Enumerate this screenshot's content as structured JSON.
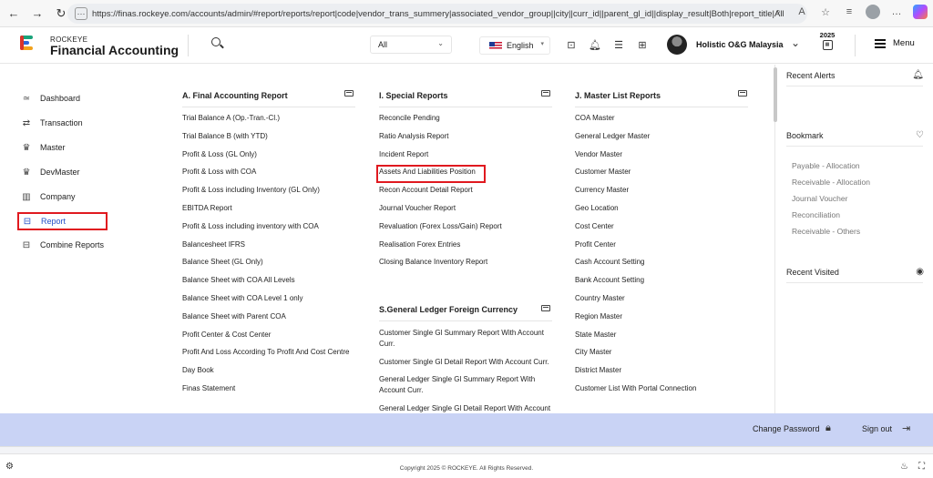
{
  "browser": {
    "url": "https://finas.rockeye.com/accounts/admin/#report/reports/report|code|vendor_trans_summery|associated_vendor_group||city||curr_id||parent_gl_id||display_result|Both|report_title|All..."
  },
  "header": {
    "brand_small": "ROCKEYE",
    "brand_big": "Financial Accounting",
    "scope_value": "All",
    "language": "English",
    "company": "Holistic O&G Malaysia",
    "year": "2025",
    "menu_label": "Menu"
  },
  "sidebar": {
    "items": [
      {
        "label": "Dashboard",
        "icon": "dashboard-icon"
      },
      {
        "label": "Transaction",
        "icon": "transaction-icon"
      },
      {
        "label": "Master",
        "icon": "crown-icon"
      },
      {
        "label": "DevMaster",
        "icon": "crown-icon"
      },
      {
        "label": "Company",
        "icon": "building-icon"
      },
      {
        "label": "Report",
        "icon": "report-icon"
      },
      {
        "label": "Combine Reports",
        "icon": "report-icon"
      }
    ]
  },
  "columns": [
    {
      "title": "A. Final Accounting Report",
      "links": [
        "Trial Balance A (Op.-Tran.-Cl.)",
        "Trial Balance B (with YTD)",
        "Profit & Loss (GL Only)",
        "Profit & Loss with COA",
        "Profit & Loss including Inventory (GL Only)",
        "EBITDA Report",
        "Profit & Loss including inventory with COA",
        "Balancesheet IFRS",
        "Balance Sheet (GL Only)",
        "Balance Sheet with COA All Levels",
        "Balance Sheet with COA Level 1 only",
        "Balance Sheet with Parent COA",
        "Profit Center & Cost Center",
        "Profit And Loss According To Profit And Cost Centre",
        "Day Book",
        "Finas Statement"
      ]
    },
    {
      "title": "I. Special Reports",
      "links": [
        "Reconcile Pending",
        "Ratio Analysis Report",
        "Incident Report",
        "Assets And Liabilities Position",
        "Recon Account Detail Report",
        "Journal Voucher Report",
        "Revaluation (Forex Loss/Gain) Report",
        "Realisation Forex Entries",
        "Closing Balance Inventory Report"
      ]
    },
    {
      "title": "J. Master List Reports",
      "links": [
        "COA Master",
        "General Ledger Master",
        "Vendor Master",
        "Customer Master",
        "Currency Master",
        "Geo Location",
        "Cost Center",
        "Profit Center",
        "Cash Account Setting",
        "Bank Account Setting",
        "Country Master",
        "Region Master",
        "State Master",
        "City Master",
        "District Master",
        "Customer List With Portal Connection"
      ]
    }
  ],
  "section_s": {
    "title": "S.General Ledger Foreign Currency",
    "links": [
      "Customer Single Gl Summary Report With Account Curr.",
      "Customer Single Gl Detail Report With Account Curr.",
      "General Ledger Single Gl Summary Report With Account Curr.",
      "General Ledger Single Gl Detail Report With Account"
    ]
  },
  "right_panel": {
    "recent_alerts": "Recent Alerts",
    "bookmark": "Bookmark",
    "bookmark_items": [
      "Payable - Allocation",
      "Receivable - Allocation",
      "Journal Voucher",
      "Reconciliation",
      "Receivable - Others"
    ],
    "recent_visited": "Recent Visited"
  },
  "bottom": {
    "change_password": "Change Password",
    "sign_out": "Sign out"
  },
  "footer": {
    "copyright": "Copyright 2025 © ROCKEYE. All Rights Reserved."
  },
  "colors": {
    "accent": "#2350c8",
    "highlight": "#e0191f",
    "band": "#c9d3f5"
  }
}
